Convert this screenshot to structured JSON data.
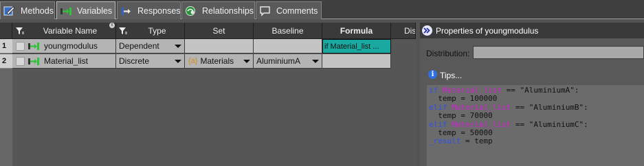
{
  "tabs": [
    {
      "label": "Methods",
      "icon": "methods-icon"
    },
    {
      "label": "Variables",
      "icon": "variable-icon"
    },
    {
      "label": "Responses",
      "icon": "responses-icon"
    },
    {
      "label": "Relationships",
      "icon": "relationships-icon"
    },
    {
      "label": "Comments",
      "icon": "comments-icon"
    }
  ],
  "grid": {
    "columns": {
      "name": "Variable Name",
      "type": "Type",
      "set": "Set",
      "baseline": "Baseline",
      "formula": "Formula",
      "dis": "Dis"
    },
    "rows": [
      {
        "num": "1",
        "name": "youngmodulus",
        "type": "Dependent",
        "set": "",
        "baseline": "",
        "formula": "if Material_list ..."
      },
      {
        "num": "2",
        "name": "Material_list",
        "type": "Discrete",
        "set": "Materials",
        "set_icon": "{a}",
        "baseline": "AluminiumA",
        "formula": ""
      }
    ]
  },
  "properties": {
    "title": "Properties of youngmodulus",
    "distribution_label": "Distribution:",
    "distribution_value": "",
    "tips_label": "Tips...",
    "code": [
      [
        {
          "t": "if",
          "c": "kw"
        },
        {
          "t": " ",
          "c": ""
        },
        {
          "t": "Material_list",
          "c": "var"
        },
        {
          "t": " == \"AluminiumA\":",
          "c": ""
        }
      ],
      [
        {
          "t": "  temp = 100000",
          "c": ""
        }
      ],
      [
        {
          "t": "elif",
          "c": "kw"
        },
        {
          "t": " ",
          "c": ""
        },
        {
          "t": "Material_list",
          "c": "var"
        },
        {
          "t": " == \"AluminiumB\":",
          "c": ""
        }
      ],
      [
        {
          "t": "  temp = 70000",
          "c": ""
        }
      ],
      [
        {
          "t": "elif",
          "c": "kw"
        },
        {
          "t": " ",
          "c": ""
        },
        {
          "t": "Material_list",
          "c": "var"
        },
        {
          "t": " == \"AluminiumC\":",
          "c": ""
        }
      ],
      [
        {
          "t": "  temp = 50000",
          "c": ""
        }
      ],
      [
        {
          "t": "_result",
          "c": "kw"
        },
        {
          "t": " = temp",
          "c": ""
        }
      ]
    ]
  },
  "colors": {
    "formula_cell": "#1aa9a0",
    "keyword": "#3050e8",
    "variable": "#d21fd2"
  }
}
